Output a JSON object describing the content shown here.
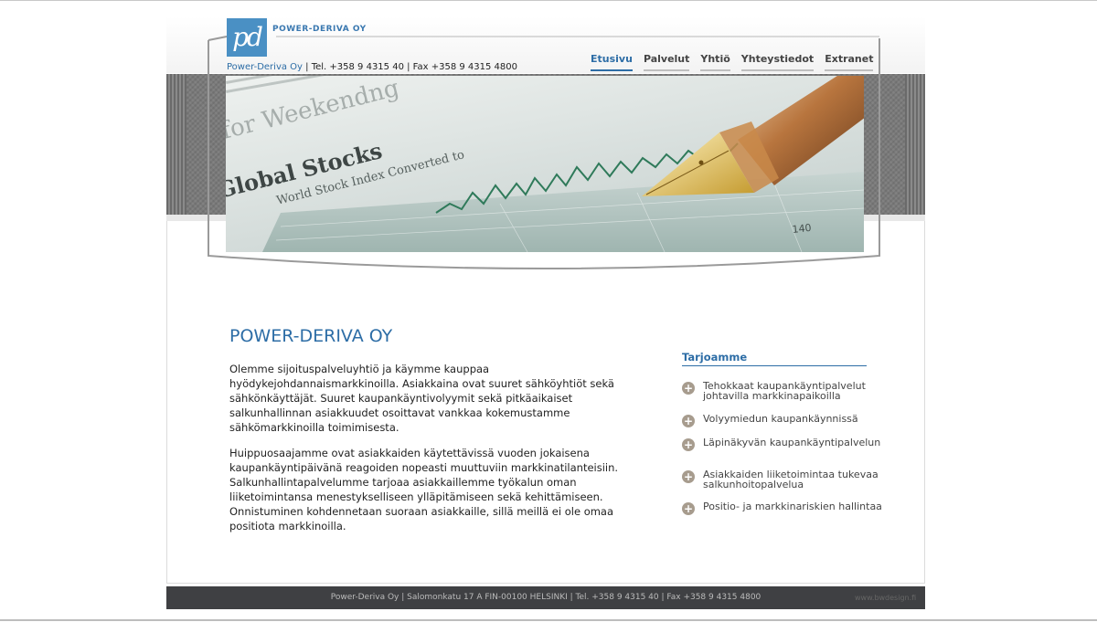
{
  "brand": {
    "logo_mark": "pd",
    "name": "POWER-DERIVA OY"
  },
  "contact_line": {
    "company": "Power-Deriva Oy",
    "phone": " | Tel. +358 9 4315 40 | Fax +358 9 4315 4800"
  },
  "nav": {
    "items": [
      {
        "label": "Etusivu"
      },
      {
        "label": "Palvelut"
      },
      {
        "label": "Yhtiö"
      },
      {
        "label": "Yhteystiedot"
      },
      {
        "label": "Extranet"
      }
    ],
    "active_index": 0
  },
  "hero": {
    "headline_1": "Global Stocks",
    "headline_2": "World Stock Index Converted to",
    "headline_3": "for Weekendng",
    "tick_label": "140"
  },
  "main": {
    "title": "POWER-DERIVA OY",
    "paragraphs": [
      "Olemme sijoituspalveluyhtiö ja käymme kauppaa hyödykejohdannaismarkkinoilla. Asiakkaina ovat suuret sähköyhtiöt sekä sähkönkäyttäjät. Suuret kaupankäyntivolyymit sekä pitkäaikaiset salkunhallinnan asiakkuudet osoittavat vankkaa kokemustamme sähkömarkkinoilla toimimisesta.",
      "Huippuosaajamme ovat asiakkaiden käytettävissä vuoden jokaisena kaupankäyntipäivänä reagoiden nopeasti muuttuviin markkinatilanteisiin. Salkunhallintapalvelumme tarjoaa asiakkaillemme työkalun oman liiketoimintansa menestykselliseen ylläpitämiseen sekä kehittämiseen. Onnistuminen kohdennetaan suoraan asiakkaille, sillä meillä ei ole omaa positiota markkinoilla."
    ]
  },
  "sidebar": {
    "title": "Tarjoamme",
    "items": [
      {
        "label": "Tehokkaat kaupankäyntipalvelut johtavilla markkinapaikoilla",
        "icon": "plus-circle-icon"
      },
      {
        "label": "Volyymiedun kaupankäynnissä",
        "icon": "plus-circle-icon"
      },
      {
        "label": "Läpinäkyvän kaupankäyntipalvelun",
        "icon": "plus-circle-icon"
      },
      {
        "label": "Asiakkaiden liiketoimintaa tukevaa salkunhoitopalvelua",
        "icon": "plus-circle-icon"
      },
      {
        "label": "Positio- ja markkinariskien hallintaa",
        "icon": "plus-circle-icon"
      }
    ]
  },
  "footer": {
    "text": "Power-Deriva Oy | Salomonkatu 17 A FIN-00100 HELSINKI | Tel. +358 9 4315 40 | Fax +358 9 4315 4800",
    "credit": "www.bwdesign.fi"
  },
  "colors": {
    "accent": "#2d6da6",
    "logo": "#4a90c4",
    "footer": "#3f4043",
    "bullet": "#a79c8e"
  }
}
